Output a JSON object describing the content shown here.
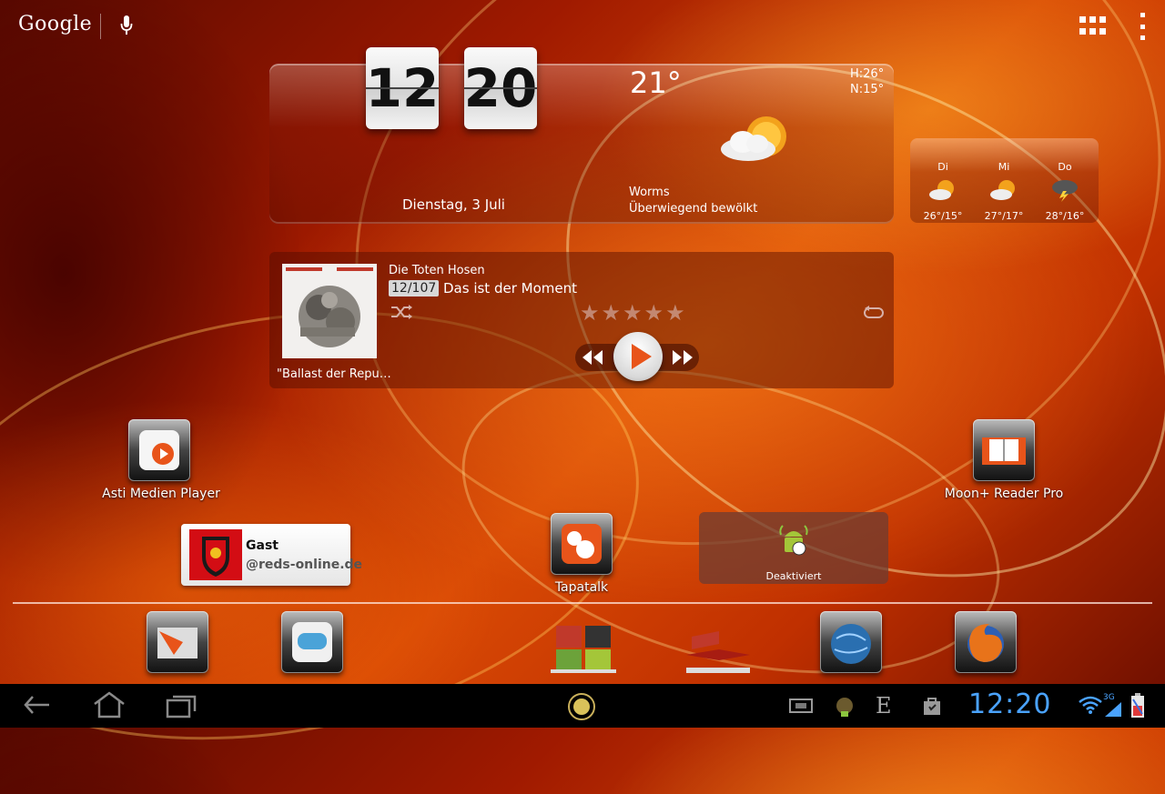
{
  "topbar": {
    "search_label": "Google",
    "mic_icon": "mic-icon",
    "apps_icon": "all-apps-icon",
    "menu_icon": "overflow-menu-icon"
  },
  "clock_widget": {
    "hour": "12",
    "minute": "20",
    "temperature": "21°",
    "high": "H:26°",
    "low": "N:15°",
    "date": "Dienstag, 3 Juli",
    "city": "Worms",
    "condition": "Überwiegend bewölkt",
    "condition_icon": "partly-cloudy-icon"
  },
  "forecast": [
    {
      "day": "Di",
      "temps": "26°/15°",
      "icon": "partly-cloudy-icon"
    },
    {
      "day": "Mi",
      "temps": "27°/17°",
      "icon": "partly-cloudy-icon"
    },
    {
      "day": "Do",
      "temps": "28°/16°",
      "icon": "thunderstorm-icon"
    }
  ],
  "music": {
    "artist": "Die Toten Hosen",
    "track_number": "12/107",
    "track_title": "Das ist der Moment",
    "album_title": "\"Ballast der Repu…",
    "rating": 0,
    "rating_max": 5
  },
  "apps": {
    "asti": "Asti Medien Player",
    "moon": "Moon+ Reader Pro",
    "tapatalk": "Tapatalk"
  },
  "contact": {
    "name": "Gast",
    "handle": "@reds-online.de"
  },
  "toggle_widget": {
    "label": "Deaktiviert"
  },
  "dock": [
    "map-app-icon",
    "messaging-app-icon",
    "folder-icon",
    "stacks-icon",
    "globe-icon",
    "firefox-icon"
  ],
  "navbar": {
    "time": "12:20",
    "network": "3G"
  },
  "colors": {
    "status_clock": "#4aa3ff",
    "contact_badge": "#d30d14",
    "play_icon": "#e8541a"
  }
}
